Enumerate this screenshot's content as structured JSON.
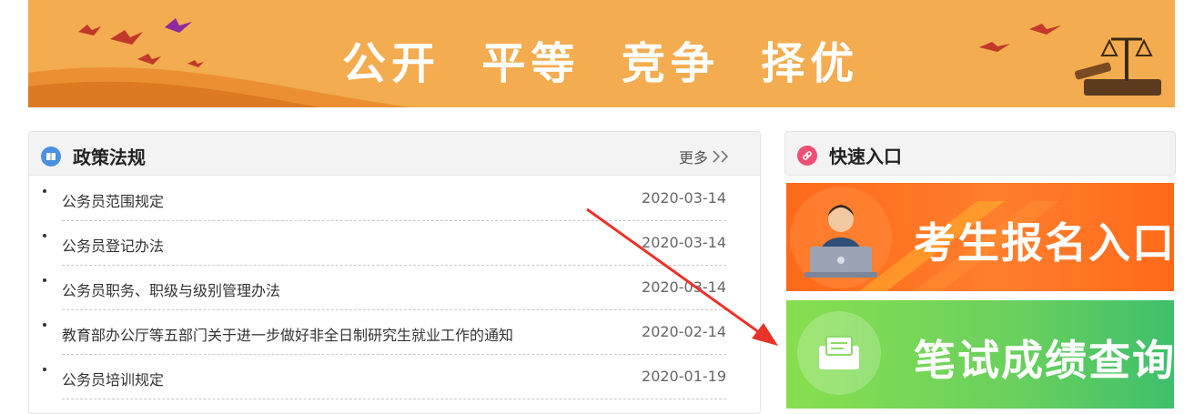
{
  "banner": {
    "slogan": "公开  平等  竞争  择优"
  },
  "policy": {
    "title": "政策法规",
    "more_label": "更多",
    "items": [
      {
        "title": "公务员范围规定",
        "date": "2020-03-14"
      },
      {
        "title": "公务员登记办法",
        "date": "2020-03-14"
      },
      {
        "title": "公务员职务、职级与级别管理办法",
        "date": "2020-03-14"
      },
      {
        "title": "教育部办公厅等五部门关于进一步做好非全日制研究生就业工作的通知",
        "date": "2020-02-14"
      },
      {
        "title": "公务员培训规定",
        "date": "2020-01-19"
      }
    ]
  },
  "quick": {
    "title": "快速入口",
    "entries": [
      {
        "label": "考生报名入口"
      },
      {
        "label": "笔试成绩查询"
      }
    ]
  },
  "colors": {
    "banner_bg": "#f3ac4f",
    "register_bg": "#ff6a1a",
    "score_bg": "#69d05e",
    "annotation_arrow": "#e8332a"
  }
}
